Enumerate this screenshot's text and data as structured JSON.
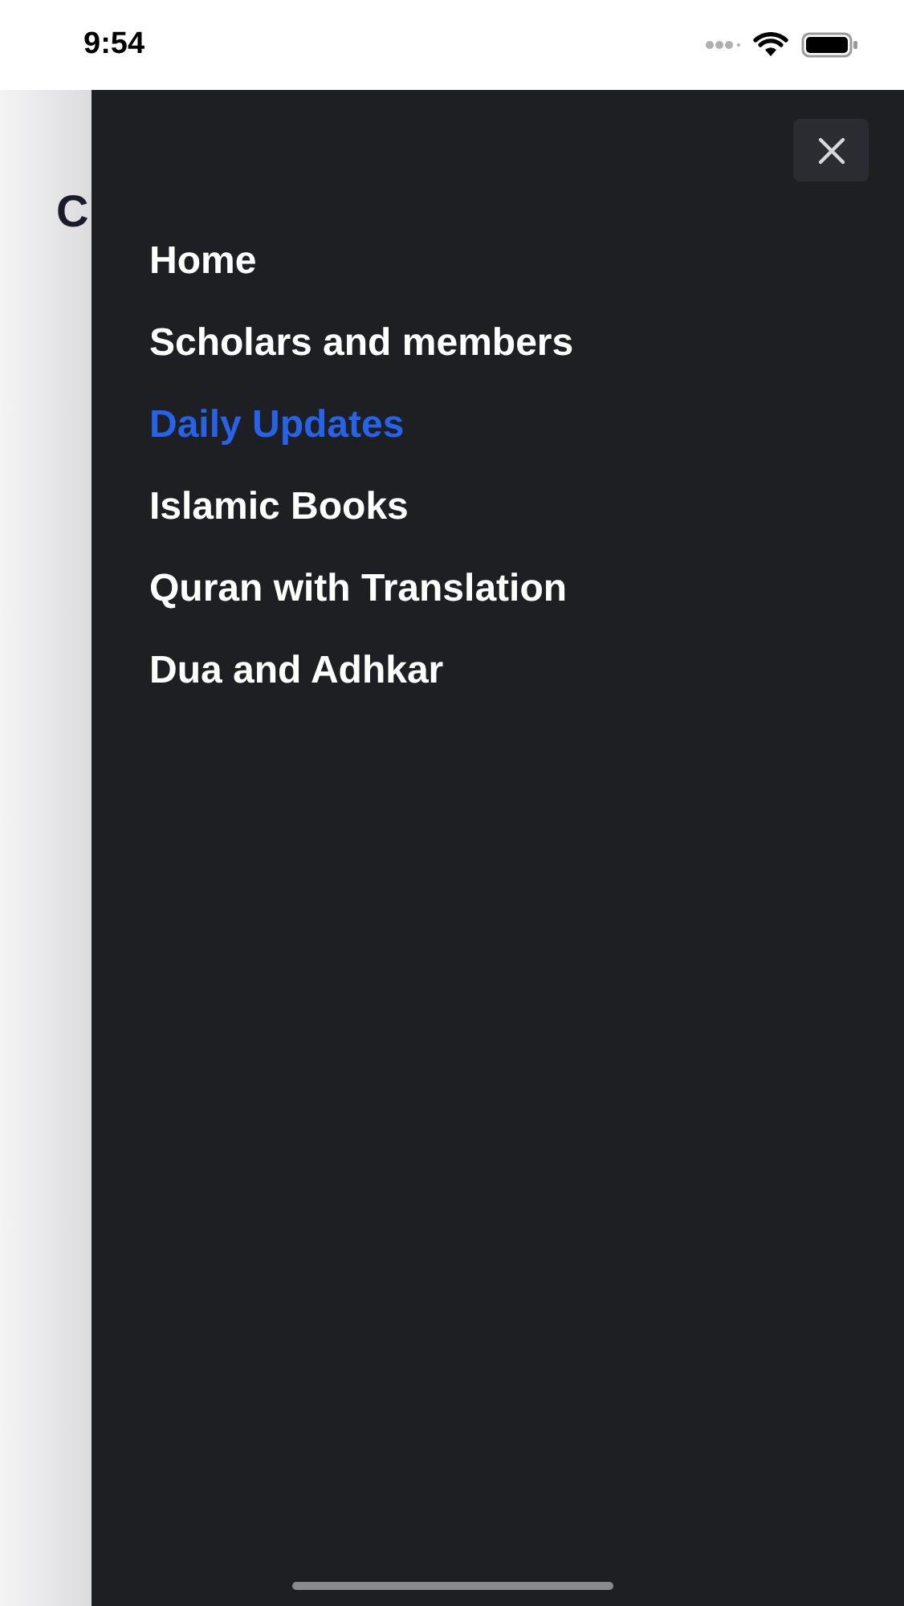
{
  "status_bar": {
    "time": "9:54"
  },
  "page": {
    "title": "C"
  },
  "drawer": {
    "items": [
      {
        "label": "Home",
        "selected": false
      },
      {
        "label": "Scholars and members",
        "selected": false
      },
      {
        "label": "Daily Updates",
        "selected": true
      },
      {
        "label": "Islamic Books",
        "selected": false
      },
      {
        "label": "Quran with Translation",
        "selected": false
      },
      {
        "label": "Dua and Adhkar",
        "selected": false
      }
    ]
  }
}
